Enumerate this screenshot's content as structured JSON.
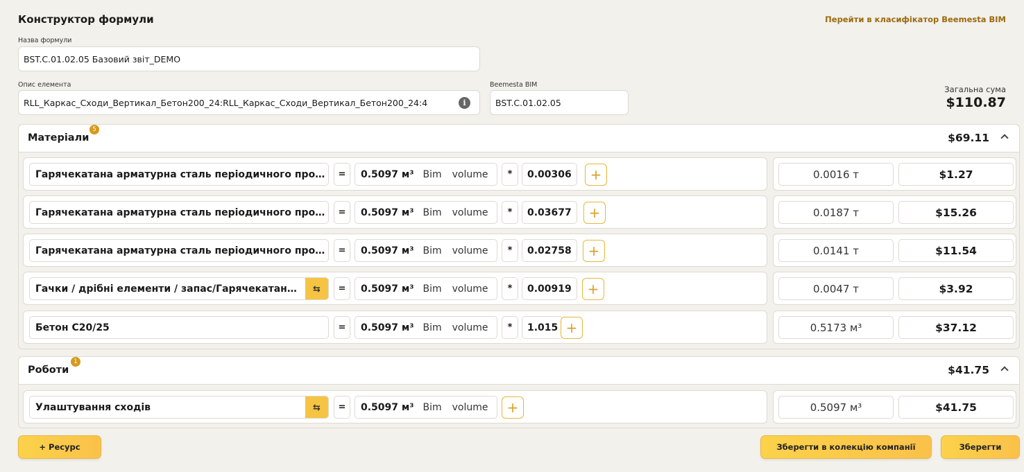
{
  "header": {
    "title": "Конструктор формули",
    "bim_link": "Перейти в класифікатор Beemesta BIM"
  },
  "form": {
    "formula_name_label": "Назва формули",
    "formula_name_value": "BST.C.01.02.05 Базовий звіт_DEMO",
    "element_desc_label": "Опис елемента",
    "element_desc_value": "RLL_Каркас_Сходи_Вертикал_Бетон200_24:RLL_Каркас_Сходи_Вертикал_Бетон200_24:4",
    "info_icon": "i",
    "bim_label": "Beemesta BIM",
    "bim_value": "BST.C.01.02.05"
  },
  "total": {
    "label": "Загальна сума",
    "value": "$110.87"
  },
  "materials": {
    "title": "Матеріали",
    "badge": "5",
    "total": "$69.11",
    "rows": [
      {
        "name": "Гарячекатана арматурна сталь періодичного профілю",
        "eq": "=",
        "volume": "0.5097 м³",
        "w1": "Bim",
        "w2": "volume",
        "mult": "*",
        "coef": "0.00306",
        "plus": "+",
        "qty": "0.0016 т",
        "price": "$1.27"
      },
      {
        "name": "Гарячекатана арматурна сталь періодичного профілю",
        "eq": "=",
        "volume": "0.5097 м³",
        "w1": "Bim",
        "w2": "volume",
        "mult": "*",
        "coef": "0.03677",
        "plus": "+",
        "qty": "0.0187 т",
        "price": "$15.26"
      },
      {
        "name": "Гарячекатана арматурна сталь періодичного профілю",
        "eq": "=",
        "volume": "0.5097 м³",
        "w1": "Bim",
        "w2": "volume",
        "mult": "*",
        "coef": "0.02758",
        "plus": "+",
        "qty": "0.0141 т",
        "price": "$11.54"
      },
      {
        "name": "Гачки / дрібні елементи / запас/Гарячекатана сталь",
        "eq": "=",
        "volume": "0.5097 м³",
        "w1": "Bim",
        "w2": "volume",
        "mult": "*",
        "coef": "0.00919",
        "plus": "+",
        "qty": "0.0047 т",
        "price": "$3.92"
      },
      {
        "name": "Бетон С20/25",
        "eq": "=",
        "volume": "0.5097 м³",
        "w1": "Bim",
        "w2": "volume",
        "mult": "*",
        "coef": "1.015",
        "plus": "+",
        "qty": "0.5173 м³",
        "price": "$37.12"
      }
    ]
  },
  "works": {
    "title": "Роботи",
    "badge": "1",
    "total": "$41.75",
    "rows": [
      {
        "name": "Улаштування сходів",
        "eq": "=",
        "volume": "0.5097 м³",
        "w1": "Bim",
        "w2": "volume",
        "plus": "+",
        "qty": "0.5097 м³",
        "price": "$41.75"
      }
    ]
  },
  "footer": {
    "resource_button": "+  Ресурс",
    "save_company_button": "Зберегти в колекцію компанії",
    "save_button": "Зберегти"
  },
  "colors": {
    "accent": "#f6c443",
    "link": "#9a6a10",
    "badge": "#d59a1c"
  }
}
